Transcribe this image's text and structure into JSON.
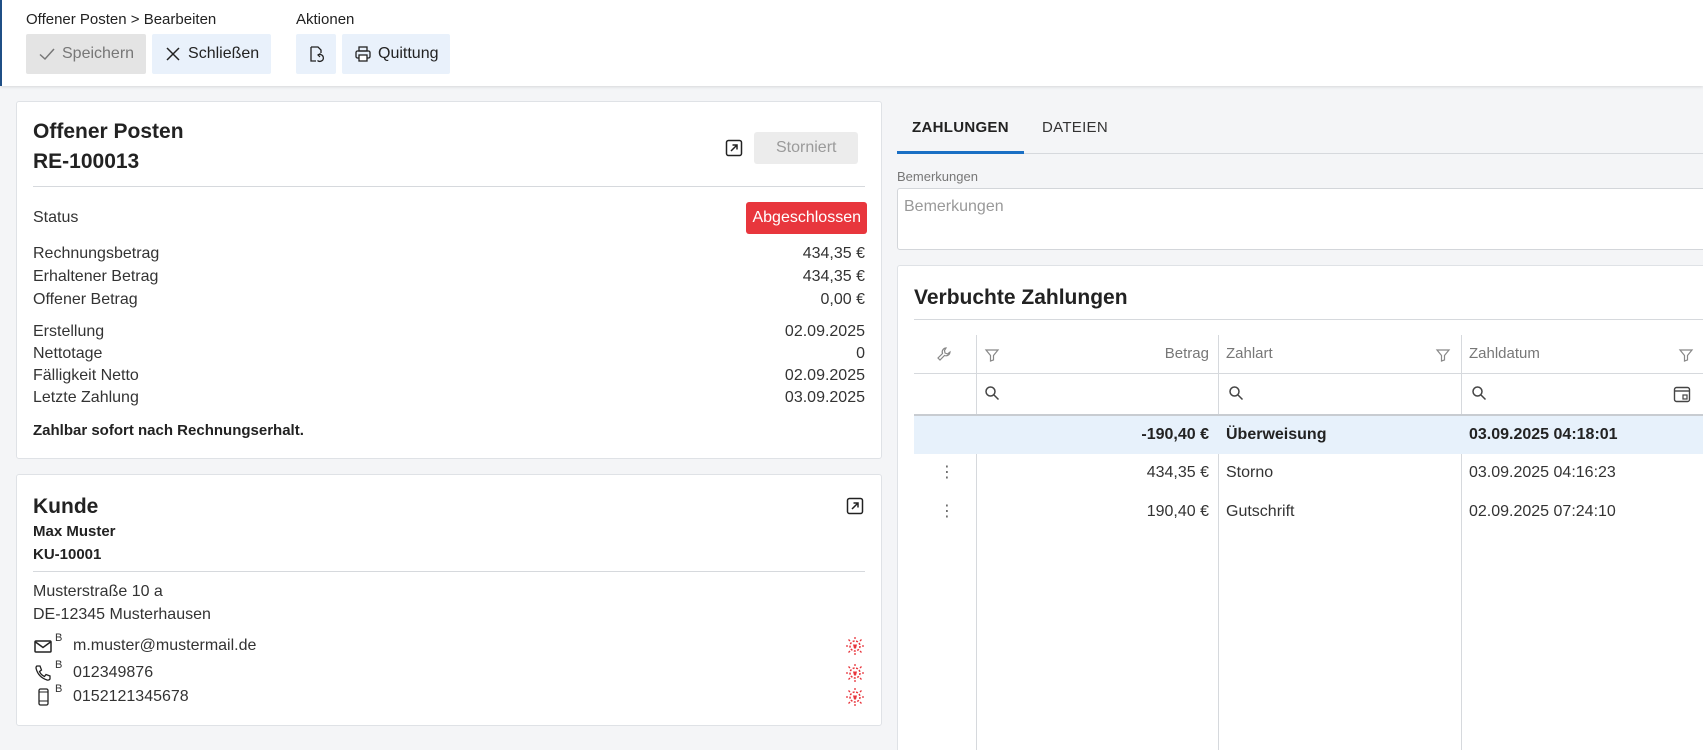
{
  "toolbar": {
    "breadcrumb": "Offener Posten > Bearbeiten",
    "actions_label": "Aktionen",
    "save_label": "Speichern",
    "close_label": "Schließen",
    "receipt_label": "Quittung"
  },
  "posten": {
    "title": "Offener Posten",
    "number": "RE-100013",
    "storniert_label": "Storniert",
    "status_label": "Status",
    "status_value": "Abgeschlossen",
    "rechnungsbetrag_label": "Rechnungsbetrag",
    "rechnungsbetrag_value": "434,35 €",
    "erhalten_label": "Erhaltener Betrag",
    "erhalten_value": "434,35 €",
    "offen_label": "Offener Betrag",
    "offen_value": "0,00 €",
    "erstellung_label": "Erstellung",
    "erstellung_value": "02.09.2025",
    "nettotage_label": "Nettotage",
    "nettotage_value": "0",
    "faelligkeit_label": "Fälligkeit Netto",
    "faelligkeit_value": "02.09.2025",
    "letzte_label": "Letzte Zahlung",
    "letzte_value": "03.09.2025",
    "terms": "Zahlbar sofort nach Rechnungserhalt."
  },
  "kunde": {
    "title": "Kunde",
    "name": "Max Muster",
    "number": "KU-10001",
    "street": "Musterstraße 10 a",
    "city": "DE-12345 Musterhausen",
    "email": "m.muster@mustermail.de",
    "phone": "012349876",
    "mobile": "0152121345678",
    "tag": "B"
  },
  "tabs": {
    "payments": "ZAHLUNGEN",
    "files": "DATEIEN"
  },
  "remarks": {
    "label": "Bemerkungen",
    "placeholder": "Bemerkungen"
  },
  "payments": {
    "title": "Verbuchte Zahlungen",
    "columns": {
      "amount": "Betrag",
      "method": "Zahlart",
      "date": "Zahldatum"
    },
    "rows": [
      {
        "amount": "-190,40 €",
        "method": "Überweisung",
        "date": "03.09.2025 04:18:01"
      },
      {
        "amount": "434,35 €",
        "method": "Storno",
        "date": "03.09.2025 04:16:23"
      },
      {
        "amount": "190,40 €",
        "method": "Gutschrift",
        "date": "02.09.2025 07:24:10"
      }
    ]
  },
  "colors": {
    "accent": "#1a6fc4",
    "status_closed": "#e8363d",
    "selected_row": "#e7f1fb",
    "button_bg": "#e9f1fb"
  },
  "icons": [
    "check-icon",
    "close-icon",
    "document-refresh-icon",
    "printer-icon",
    "external-link-icon",
    "mail-icon",
    "phone-icon",
    "mobile-icon",
    "alert-icon",
    "wrench-icon",
    "filter-icon",
    "search-icon",
    "calendar-icon",
    "more-vertical-icon"
  ]
}
